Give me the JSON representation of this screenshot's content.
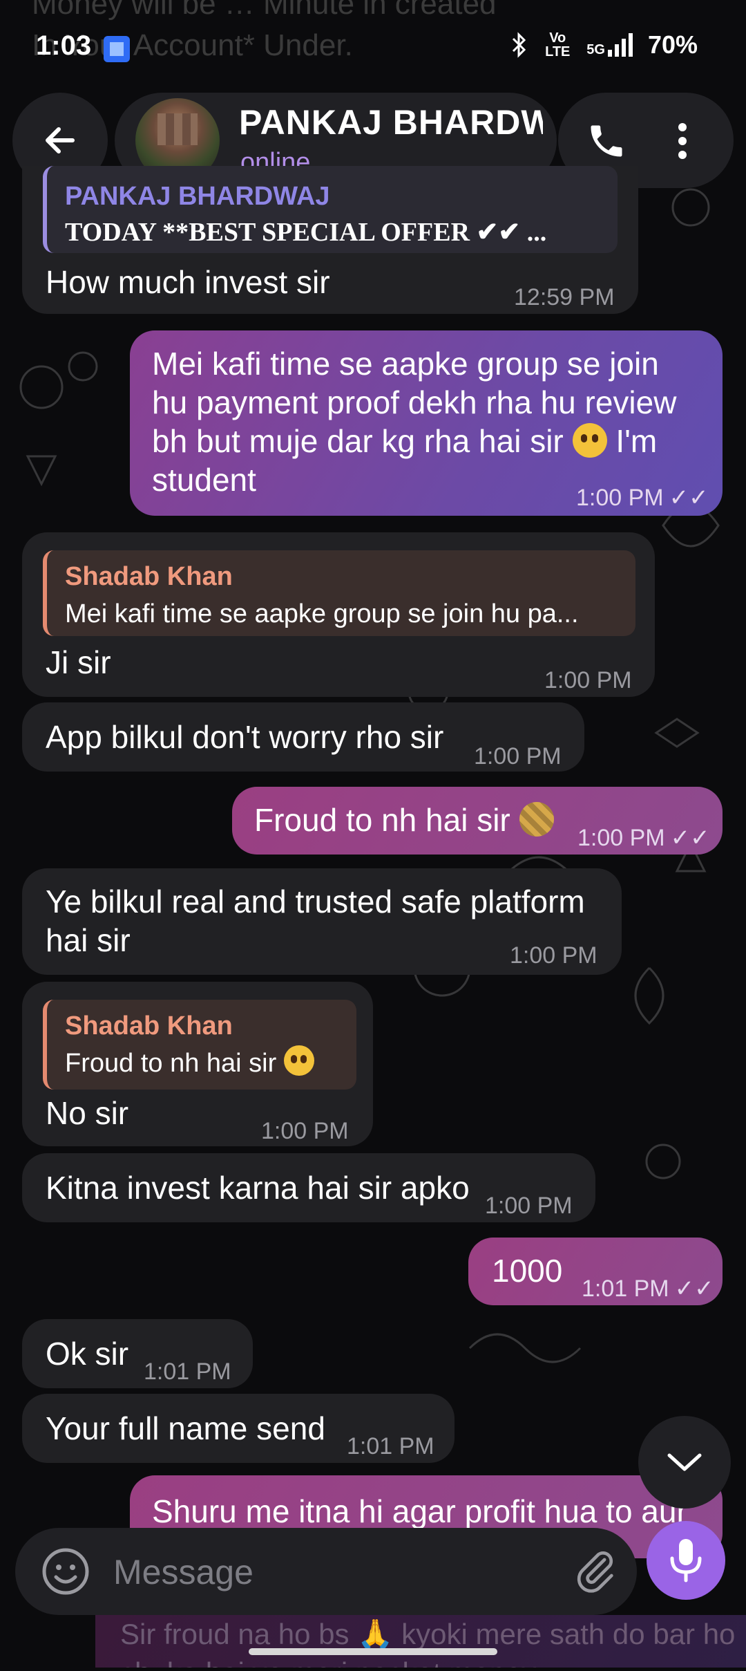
{
  "status_bar": {
    "time": "1:03",
    "network": "Vo LTE",
    "signal": "5G",
    "battery": "70%"
  },
  "ghost_top": {
    "line1": "Money will be … Minute in created",
    "line2": "In Your Account* Under."
  },
  "header": {
    "contact_name": "PANKAJ BHARDWAJ",
    "contact_status": "online",
    "icons": {
      "back": "back-arrow-icon",
      "call": "phone-icon",
      "menu": "more-vertical-icon"
    }
  },
  "messages": [
    {
      "id": "m1",
      "dir": "in",
      "quote_name": "PANKAJ BHARDWAJ",
      "quote_text": "TODAY **BEST SPECIAL OFFER ✔✔ ...",
      "text": "How much invest sir",
      "time": "12:59 PM"
    },
    {
      "id": "m2",
      "dir": "out",
      "text": "Mei kafi time se aapke group se join hu payment proof dekh rha hu review bh but muje dar kg rha hai sir 🥺 I'm student",
      "line1": "Mei kafi time se aapke group se join",
      "line2": "hu payment proof dekh rha hu review",
      "line3": "bh but muje dar kg rha hai sir",
      "line3b": "I'm",
      "line4": "student",
      "time": "1:00 PM"
    },
    {
      "id": "m3",
      "dir": "in",
      "quote_name": "Shadab Khan",
      "quote_text": "Mei kafi time se aapke group se join hu pa...",
      "text": "Ji sir",
      "time": "1:00 PM"
    },
    {
      "id": "m4",
      "dir": "in",
      "text": "App bilkul don't worry rho sir",
      "time": "1:00 PM"
    },
    {
      "id": "m5",
      "dir": "out",
      "text": "Froud to nh hai sir",
      "time": "1:00 PM"
    },
    {
      "id": "m6",
      "dir": "in",
      "line1": "Ye bilkul real and trusted safe platform",
      "line2": "hai sir",
      "time": "1:00 PM"
    },
    {
      "id": "m7",
      "dir": "in",
      "quote_name": "Shadab Khan",
      "quote_text": "Froud to nh hai sir",
      "text": "No sir",
      "time": "1:00 PM"
    },
    {
      "id": "m8",
      "dir": "in",
      "text": "Kitna invest karna hai sir apko",
      "time": "1:00 PM"
    },
    {
      "id": "m9",
      "dir": "out",
      "text": "1000",
      "time": "1:01 PM"
    },
    {
      "id": "m10",
      "dir": "in",
      "text": "Ok sir",
      "time": "1:01 PM"
    },
    {
      "id": "m11",
      "dir": "in",
      "text": "Your full name send",
      "time": "1:01 PM"
    },
    {
      "id": "m12",
      "dir": "out",
      "text": "Shuru me itna hi agar profit hua to aur",
      "time": ""
    }
  ],
  "composer": {
    "placeholder": "Message",
    "icons": {
      "emoji": "smiley-icon",
      "attach": "paperclip-icon",
      "mic": "microphone-icon",
      "scroll": "chevron-down-icon"
    }
  },
  "below_input_text": "Sir froud na ho bs 🙏 kyoki mere sath do bar ho chuka hai ye meri pocket money"
}
